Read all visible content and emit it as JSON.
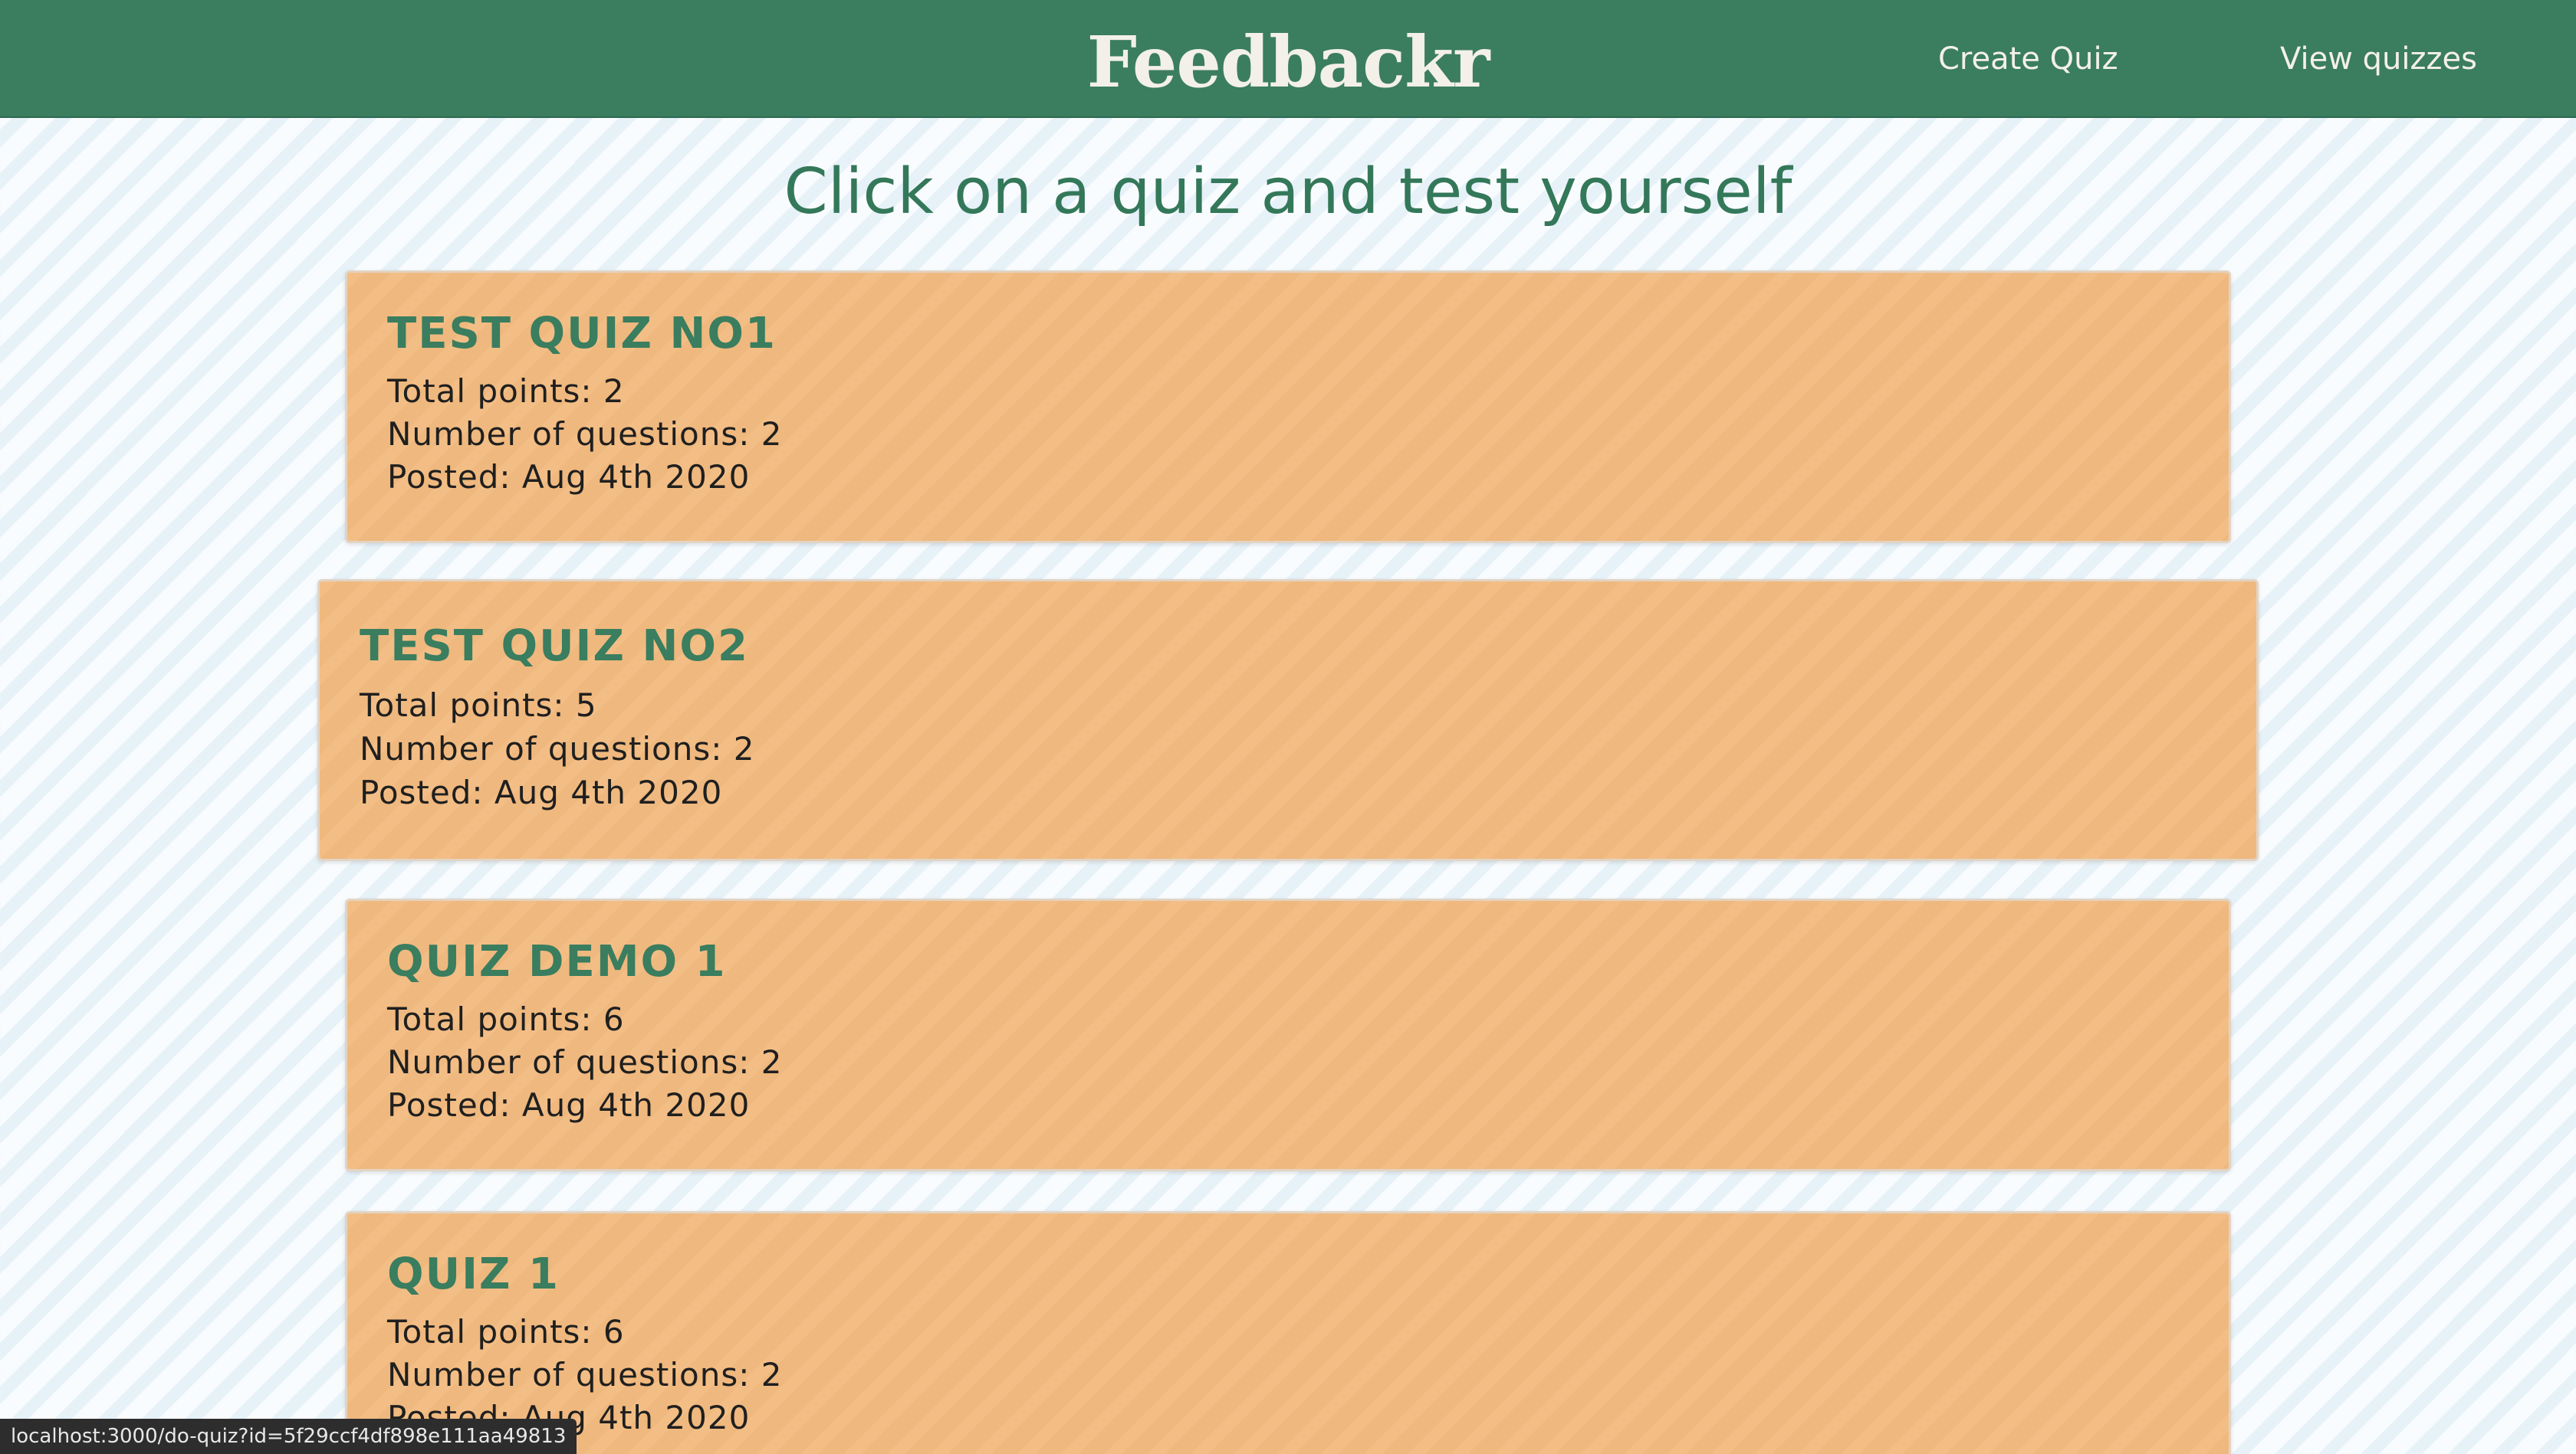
{
  "header": {
    "brand": "Feedbackr",
    "nav": [
      {
        "label": "Create Quiz"
      },
      {
        "label": "View quizzes"
      }
    ]
  },
  "main": {
    "heading": "Click on a quiz and test yourself",
    "quizzes": [
      {
        "title": "TEST QUIZ NO1",
        "total_points": "Total points: 2",
        "num_questions": "Number of questions: 2",
        "posted": "Posted: Aug 4th 2020"
      },
      {
        "title": "TEST QUIZ NO2",
        "total_points": "Total points: 5",
        "num_questions": "Number of questions: 2",
        "posted": "Posted: Aug 4th 2020"
      },
      {
        "title": "QUIZ DEMO 1",
        "total_points": "Total points: 6",
        "num_questions": "Number of questions: 2",
        "posted": "Posted: Aug 4th 2020"
      },
      {
        "title": "QUIZ 1",
        "total_points": "Total points: 6",
        "num_questions": "Number of questions: 2",
        "posted": "Posted: Aug 4th 2020"
      }
    ]
  },
  "status_bar": {
    "url": "localhost:3000/do-quiz?id=5f29ccf4df898e111aa49813"
  },
  "colors": {
    "navbar": "#3b7d5f",
    "accent_text": "#34785a",
    "card": "#f3bb80"
  }
}
